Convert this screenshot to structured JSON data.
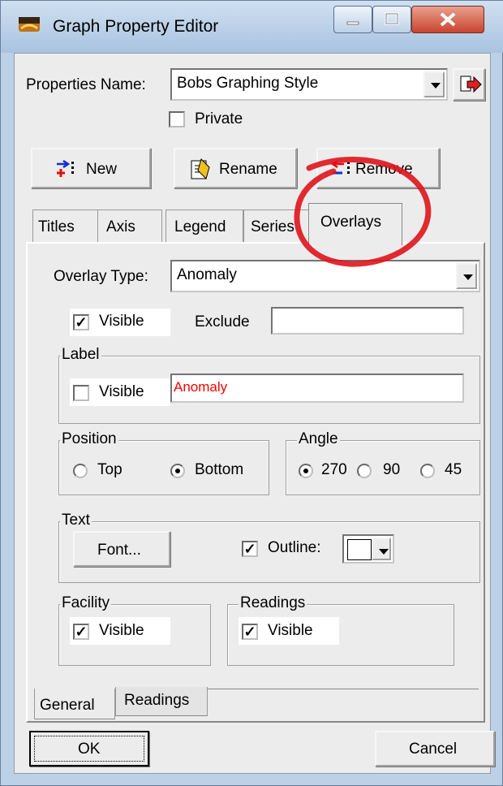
{
  "window": {
    "title": "Graph Property Editor"
  },
  "properties": {
    "name_label": "Properties Name:",
    "name_value": "Bobs Graphing Style",
    "private_label": "Private",
    "private_checked": false
  },
  "toolbar": {
    "new_label": "New",
    "rename_label": "Rename",
    "remove_label": "Remove"
  },
  "tabs": {
    "titles": "Titles",
    "axis": "Axis",
    "legend": "Legend",
    "series": "Series",
    "overlays": "Overlays",
    "active": "Overlays"
  },
  "overlay": {
    "type_label": "Overlay Type:",
    "type_value": "Anomaly"
  },
  "visible": {
    "label": "Visible",
    "checked": true
  },
  "exclude": {
    "label": "Exclude",
    "value": ""
  },
  "label_group": {
    "title": "Label",
    "visible_label": "Visible",
    "visible_checked": false,
    "text_value": "Anomaly",
    "text_color": "#ff0000"
  },
  "position": {
    "title": "Position",
    "top_label": "Top",
    "bottom_label": "Bottom",
    "selected": "Bottom"
  },
  "angle": {
    "title": "Angle",
    "opt1": "270",
    "opt2": "90",
    "opt3": "45",
    "selected": "270"
  },
  "text_group": {
    "title": "Text",
    "font_button": "Font...",
    "outline_label": "Outline:",
    "outline_checked": true,
    "outline_color": "#ffffff"
  },
  "facility": {
    "title": "Facility",
    "visible_label": "Visible",
    "checked": true
  },
  "readings": {
    "title": "Readings",
    "visible_label": "Visible",
    "checked": true
  },
  "subtabs": {
    "general": "General",
    "readings": "Readings",
    "active": "General"
  },
  "buttons": {
    "ok": "OK",
    "cancel": "Cancel"
  },
  "annotation": {
    "color": "#e0141c",
    "shape": "hand-drawn ellipse around Overlays tab"
  }
}
